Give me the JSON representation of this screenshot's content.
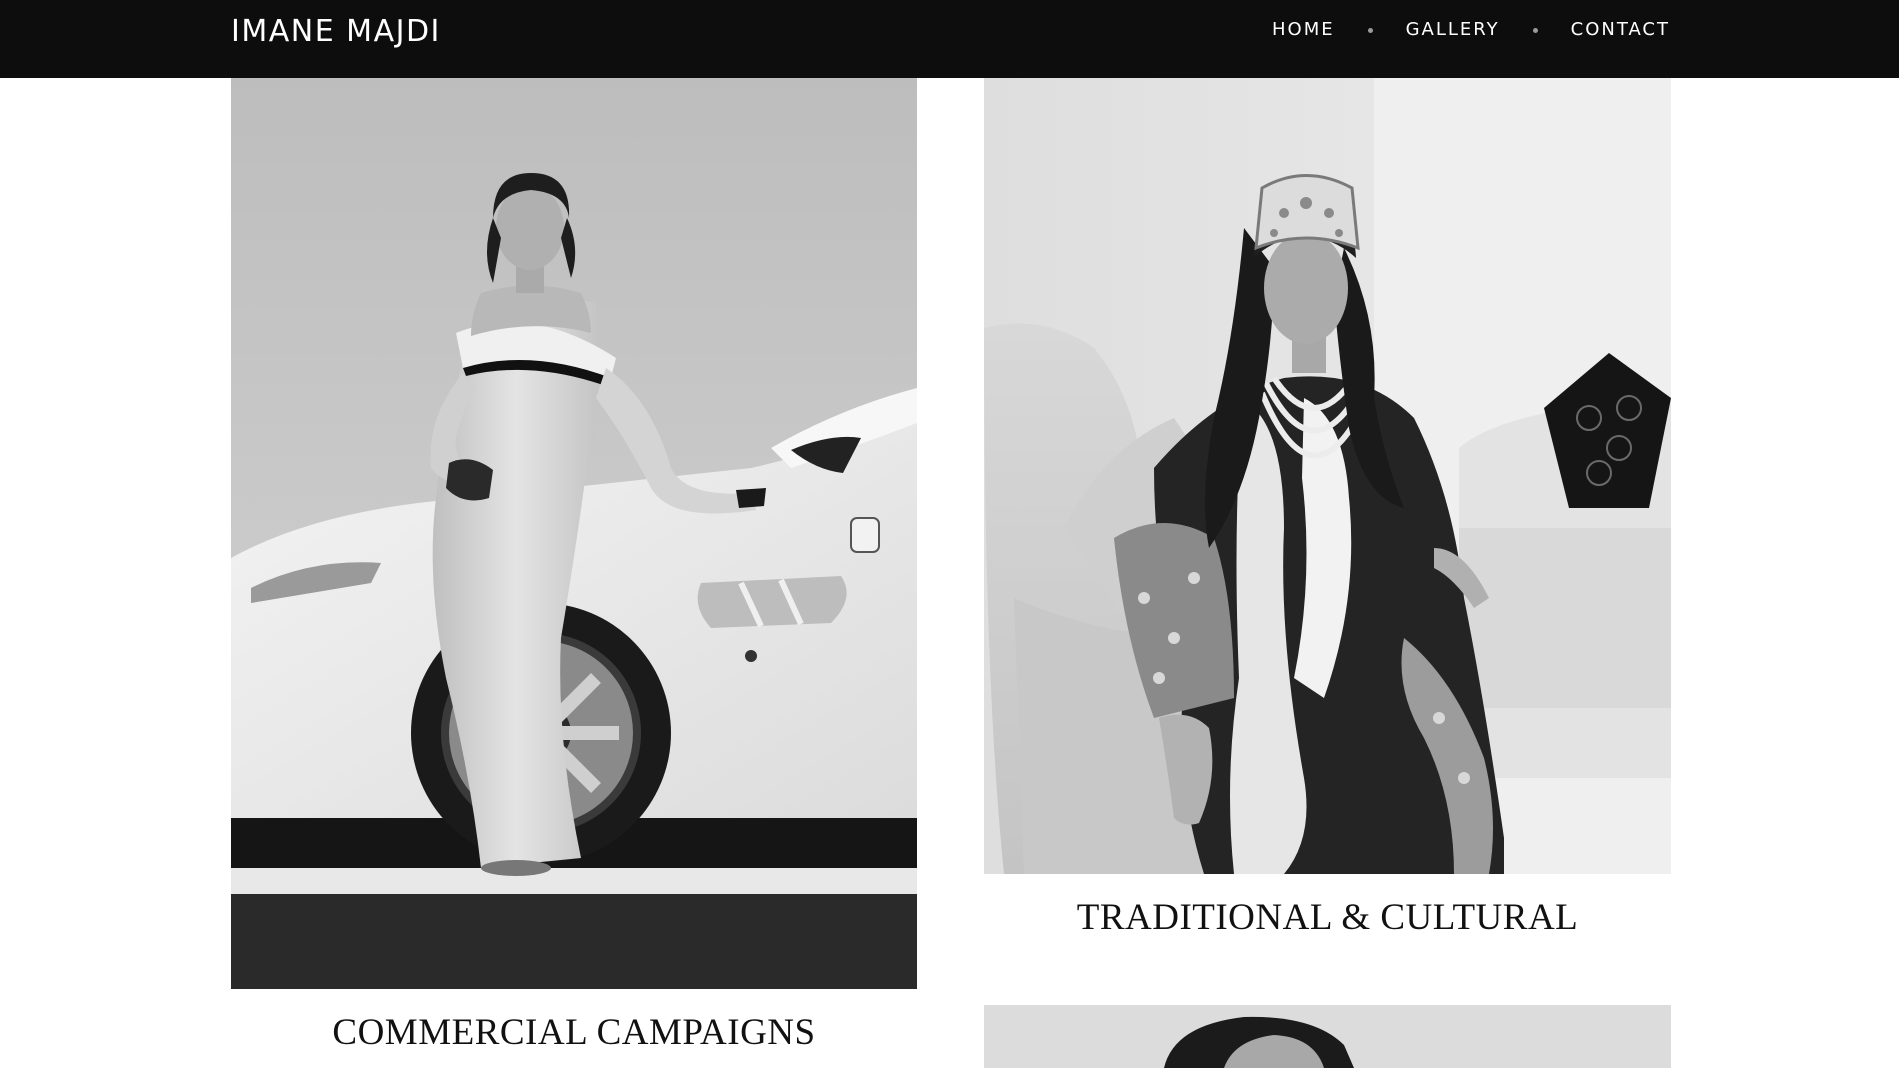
{
  "header": {
    "brand": "IMANE MAJDI",
    "nav": [
      {
        "label": "HOME"
      },
      {
        "label": "GALLERY"
      },
      {
        "label": "CONTACT"
      }
    ]
  },
  "gallery": {
    "items": [
      {
        "caption": "COMMERCIAL CAMPAIGNS"
      },
      {
        "caption": "TRADITIONAL & CULTURAL"
      },
      {
        "caption": ""
      }
    ]
  },
  "colors": {
    "header_bg": "#0d0d0d",
    "header_text": "#ffffff",
    "page_bg": "#ffffff",
    "caption_text": "#111111"
  }
}
